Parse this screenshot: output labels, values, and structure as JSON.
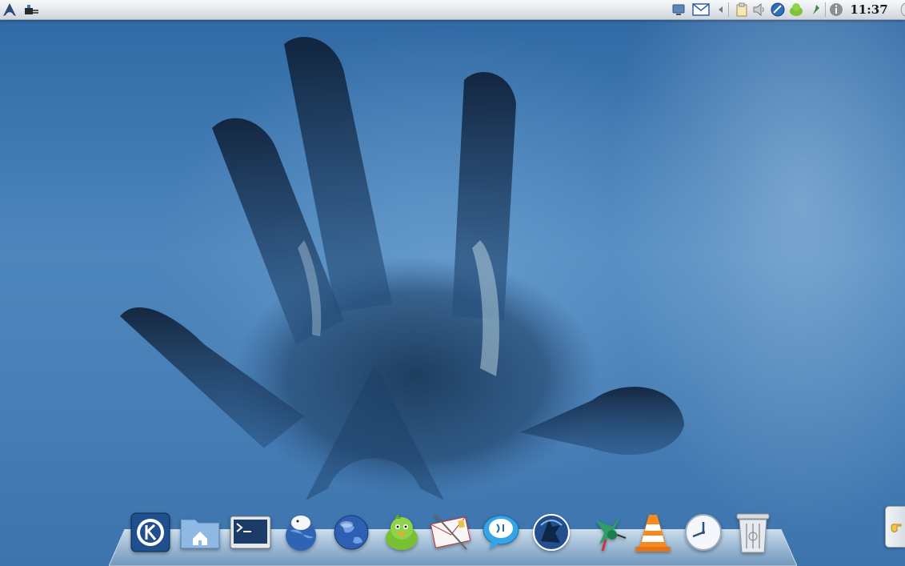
{
  "top_panel": {
    "launcher_icon": "arch-logo-icon",
    "left_applets": [
      "arch-logo-icon",
      "network-plug-icon"
    ],
    "tray_icons": [
      "screen-monitor-icon",
      "mail-envelope-icon",
      "collapse-arrow-icon",
      "clipboard-icon",
      "volume-speaker-icon",
      "network-globe-icon",
      "pidgin-bird-icon",
      "pushpin-icon",
      "info-icon"
    ],
    "clock": "11:37"
  },
  "dock": {
    "items": [
      {
        "name": "kde-menu",
        "icon": "kde-gear-icon"
      },
      {
        "name": "home-folder",
        "icon": "home-folder-icon"
      },
      {
        "name": "terminal",
        "icon": "terminal-icon"
      },
      {
        "name": "web-browser-penguin",
        "icon": "globe-penguin-icon"
      },
      {
        "name": "web-browser",
        "icon": "blue-globe-icon"
      },
      {
        "name": "instant-messenger",
        "icon": "green-bird-icon"
      },
      {
        "name": "mail-client",
        "icon": "airmail-envelope-icon"
      },
      {
        "name": "chat-client",
        "icon": "speech-bubble-icon"
      },
      {
        "name": "network-tool",
        "icon": "wolf-icon"
      },
      {
        "name": "hummingbird-app",
        "icon": "hummingbird-icon"
      },
      {
        "name": "media-player",
        "icon": "traffic-cone-icon"
      },
      {
        "name": "clock-app",
        "icon": "analog-clock-icon"
      },
      {
        "name": "trash",
        "icon": "trash-can-icon"
      }
    ]
  },
  "side_panel": {
    "icon": "pointing-hand-icon"
  }
}
